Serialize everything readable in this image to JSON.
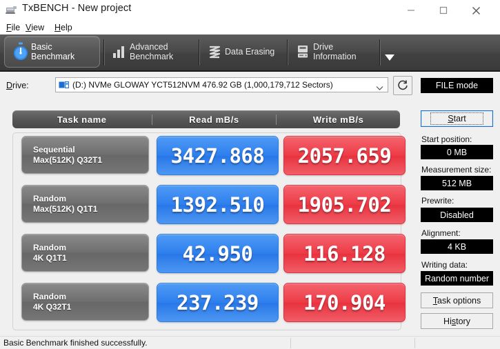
{
  "window": {
    "title": "TxBENCH - New project",
    "icon": "app-icon",
    "controls": {
      "minimize": "minimize-icon",
      "maximize": "maximize-icon",
      "close": "close-icon"
    }
  },
  "menu": {
    "items": [
      {
        "label": "File",
        "accel": "F"
      },
      {
        "label": "View",
        "accel": "V"
      },
      {
        "label": "Help",
        "accel": "H"
      }
    ]
  },
  "tabs": [
    {
      "label": "Basic\nBenchmark",
      "icon": "stopwatch-icon",
      "active": true
    },
    {
      "label": "Advanced\nBenchmark",
      "icon": "bar-chart-icon",
      "active": false
    },
    {
      "label": "Data Erasing",
      "icon": "shred-icon",
      "active": false
    },
    {
      "label": "Drive\nInformation",
      "icon": "drive-info-icon",
      "active": false
    }
  ],
  "tab_overflow_icon": "chevron-down-icon",
  "drive": {
    "label": "Drive:",
    "icon": "drive-icon",
    "value": "(D:) NVMe GLOWAY YCT512NVM  476.92 GB (1,000,179,712 Sectors)",
    "caret_icon": "chevron-down-icon",
    "refresh_icon": "refresh-icon"
  },
  "results": {
    "columns": [
      "Task name",
      "Read mB/s",
      "Write mB/s"
    ],
    "rows": [
      {
        "name_line1": "Sequential",
        "name_line2": "Max(512K) Q32T1",
        "read": "3427.868",
        "write": "2057.659"
      },
      {
        "name_line1": "Random",
        "name_line2": "Max(512K) Q1T1",
        "read": "1392.510",
        "write": "1905.702"
      },
      {
        "name_line1": "Random",
        "name_line2": "4K Q1T1",
        "read": "42.950",
        "write": "116.128"
      },
      {
        "name_line1": "Random",
        "name_line2": "4K Q32T1",
        "read": "237.239",
        "write": "170.904"
      }
    ]
  },
  "sidebar": {
    "mode_badge": "FILE mode",
    "start_button": "Start",
    "start_accel": "S",
    "fields": [
      {
        "label": "Start position:",
        "value": "0 MB"
      },
      {
        "label": "Measurement size:",
        "value": "512 MB"
      },
      {
        "label": "Prewrite:",
        "value": "Disabled"
      },
      {
        "label": "Alignment:",
        "value": "4 KB"
      },
      {
        "label": "Writing data:",
        "value": "Random number"
      }
    ],
    "task_options_button": "Task options",
    "task_options_accel": "T",
    "history_button": "History",
    "history_accel": "s"
  },
  "status": {
    "message": "Basic Benchmark finished successfully."
  },
  "colors": {
    "read_blue": "#2e7fee",
    "write_red": "#ed3b46",
    "tabstrip_dark": "#4a4a4a",
    "badge_black": "#000000"
  }
}
